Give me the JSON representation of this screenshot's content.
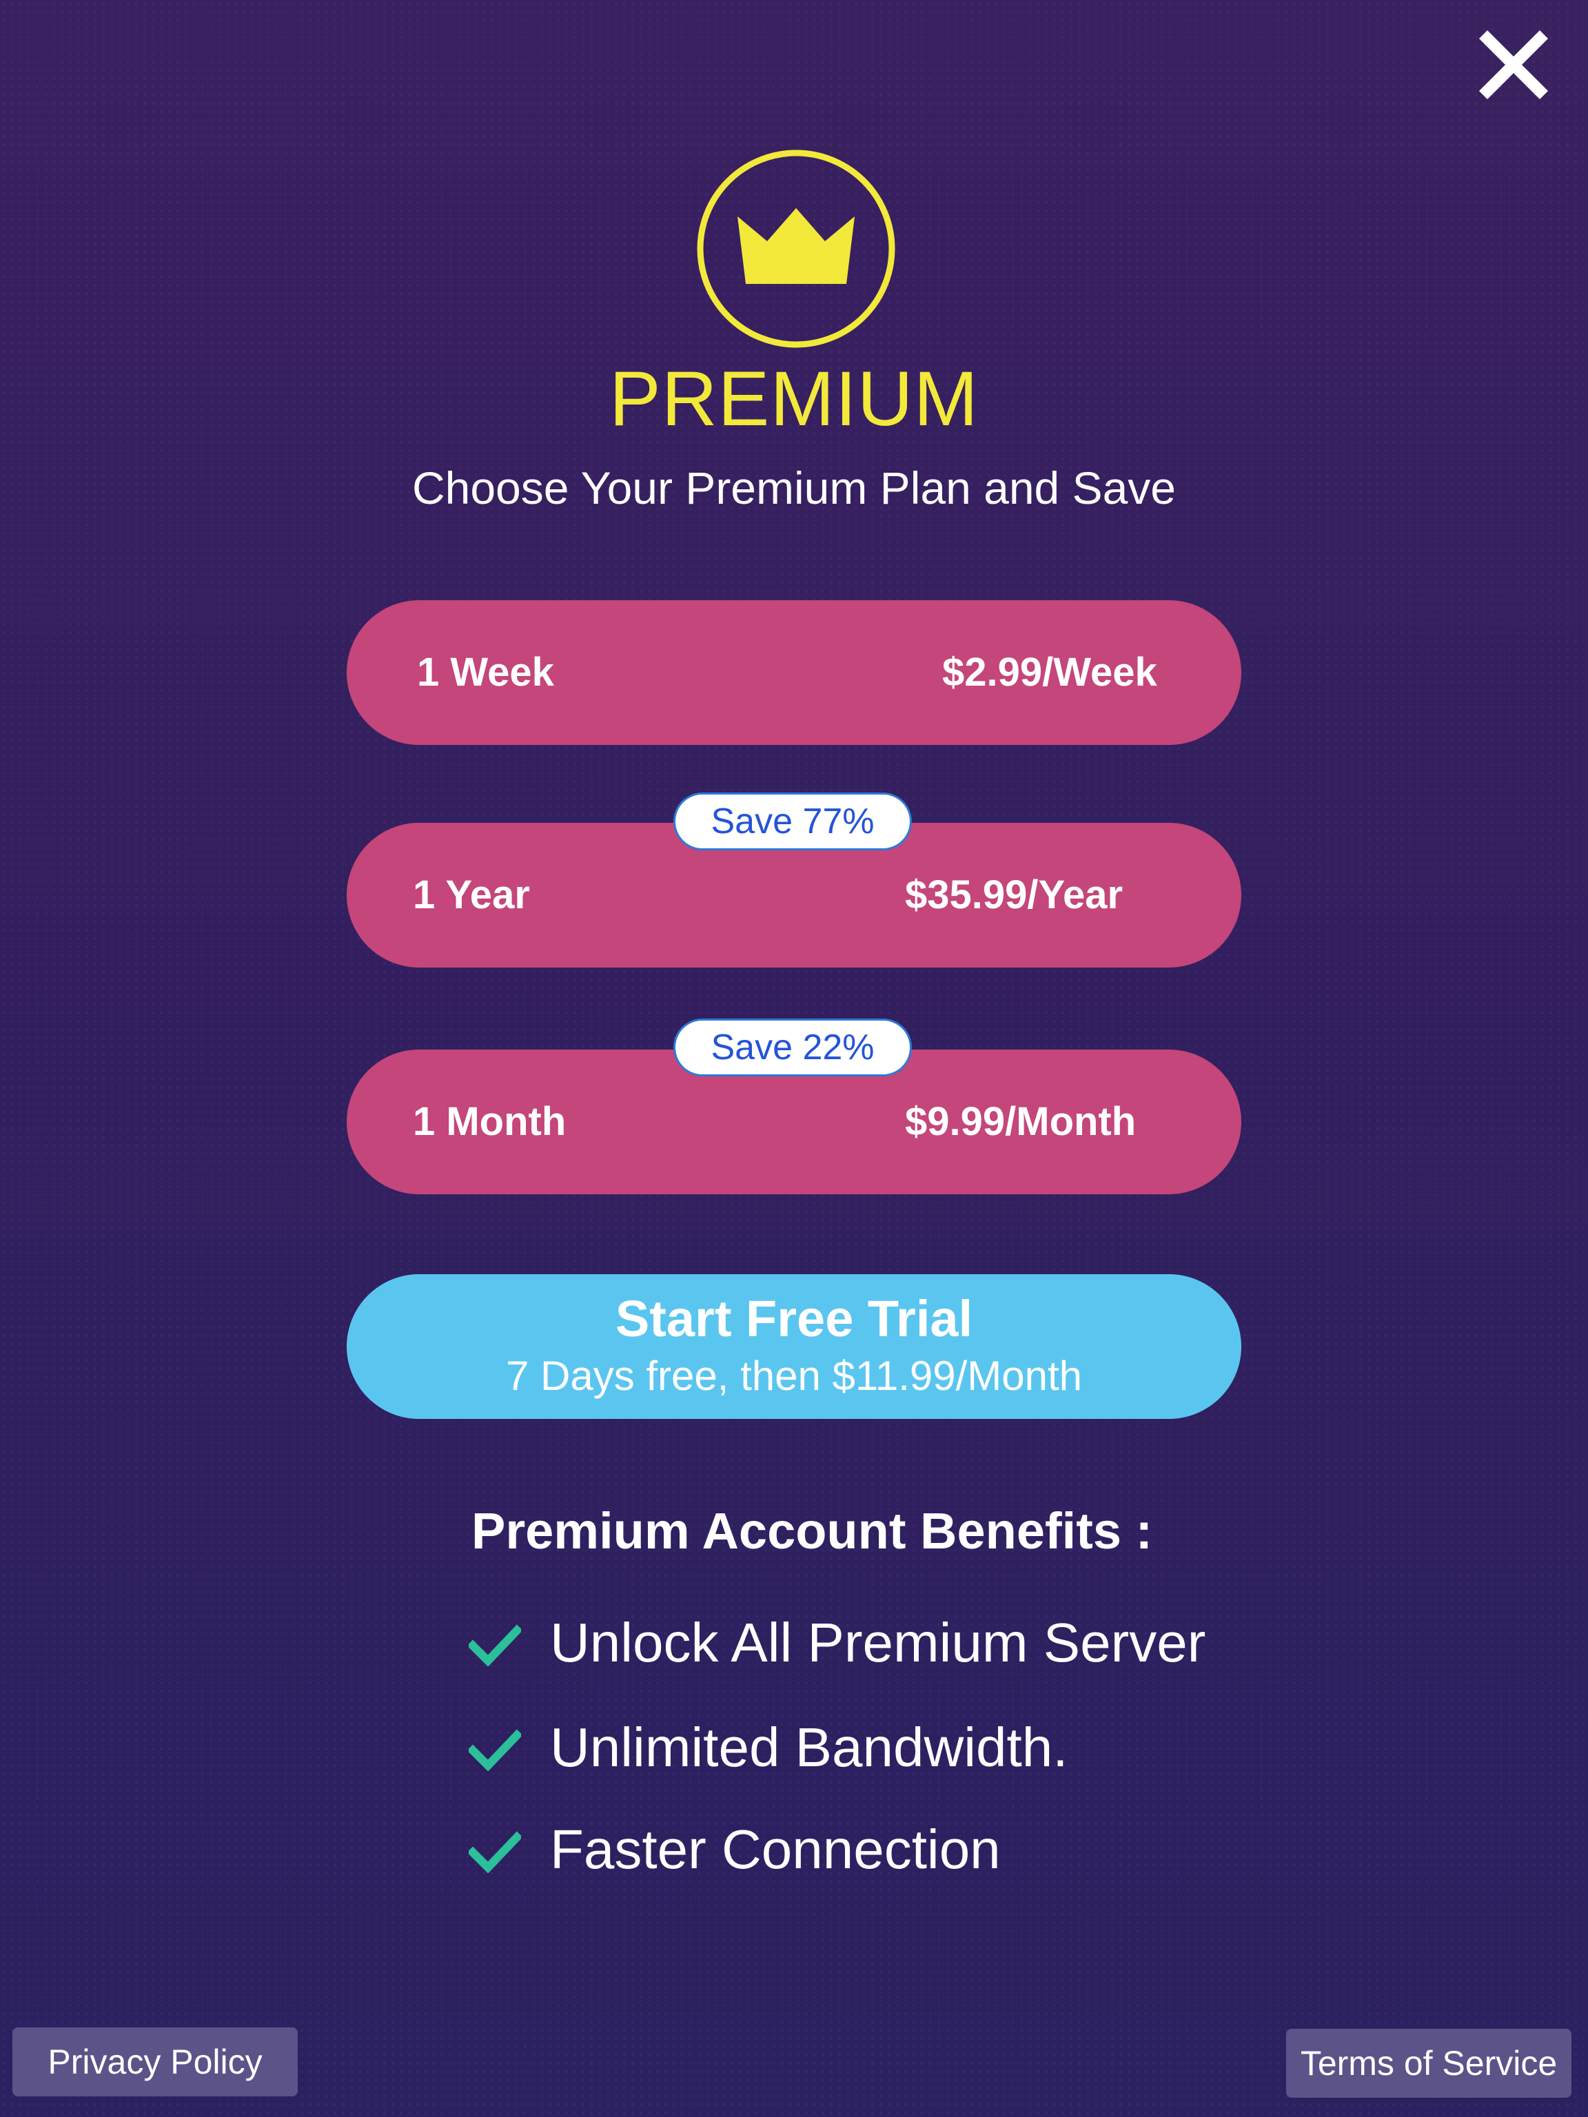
{
  "header": {
    "close_icon": "close-icon",
    "badge_icon": "crown-icon",
    "title": "PREMIUM",
    "subtitle": "Choose Your Premium Plan and Save"
  },
  "colors": {
    "background": "#331f5f",
    "title": "#f2e93b",
    "plan_button": "#c4467a",
    "trial_button": "#5ac6f0",
    "badge_text": "#2454d8",
    "check": "#2bbf9a",
    "footer_button": "#5c5388"
  },
  "plans": [
    {
      "name": "1 Week",
      "price": "$2.99/Week",
      "badge": ""
    },
    {
      "name": "1 Year",
      "price": "$35.99/Year",
      "badge": "Save 77%"
    },
    {
      "name": "1 Month",
      "price": "$9.99/Month",
      "badge": "Save 22%"
    }
  ],
  "trial": {
    "title": "Start Free Trial",
    "subtitle": "7 Days free, then $11.99/Month"
  },
  "benefits": {
    "title": "Premium Account Benefits :",
    "icon": "check-icon",
    "items": [
      "Unlock All Premium Server",
      "Unlimited Bandwidth.",
      "Faster Connection"
    ]
  },
  "footer": {
    "privacy": "Privacy Policy",
    "terms": "Terms of Service"
  }
}
